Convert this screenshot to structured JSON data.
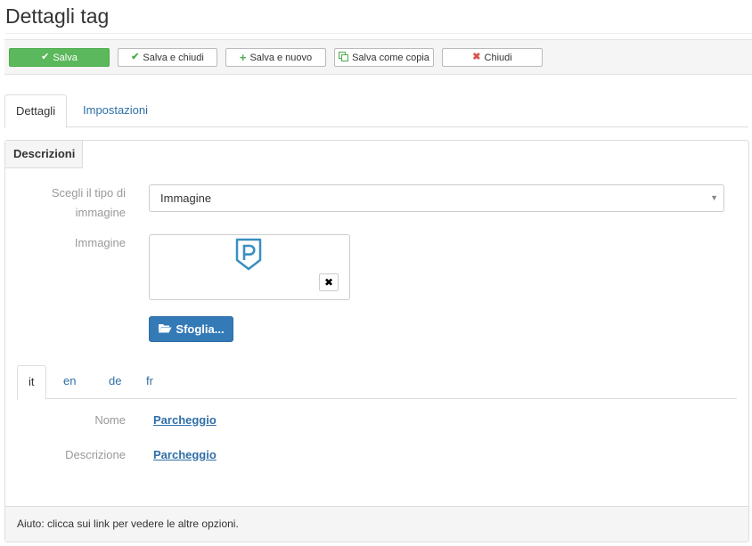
{
  "page": {
    "title": "Dettagli tag"
  },
  "toolbar": {
    "save": "Salva",
    "save_close": "Salva e chiudi",
    "save_new": "Salva e nuovo",
    "save_copy": "Salva come copia",
    "close": "Chiudi",
    "icons": {
      "save": "check-icon",
      "save_close": "check-icon",
      "save_new": "plus-icon",
      "save_copy": "copy-icon",
      "close": "close-icon"
    },
    "colors": {
      "primary": "#5cb85c",
      "check": "#4cae4c",
      "close": "#d9534f"
    }
  },
  "tabs": [
    {
      "label": "Dettagli",
      "active": true
    },
    {
      "label": "Impostazioni",
      "active": false
    }
  ],
  "panel": {
    "heading": "Descrizioni",
    "image_type": {
      "label": "Scegli il tipo di immagine",
      "value": "Immagine"
    },
    "image": {
      "label": "Immagine",
      "preview_icon": "parking-shield-icon",
      "remove_icon": "close-icon"
    },
    "browse_label": "Sfoglia...",
    "browse_color": "#337ab7"
  },
  "lang_tabs": [
    {
      "label": "it",
      "active": true
    },
    {
      "label": "en",
      "active": false
    },
    {
      "label": "de",
      "active": false
    },
    {
      "label": "fr",
      "active": false
    }
  ],
  "fields": [
    {
      "label": "Nome",
      "value": "Parcheggio"
    },
    {
      "label": "Descrizione",
      "value": "Parcheggio"
    }
  ],
  "footer": {
    "help": "Aiuto: clicca sui link per vedere le altre opzioni."
  }
}
